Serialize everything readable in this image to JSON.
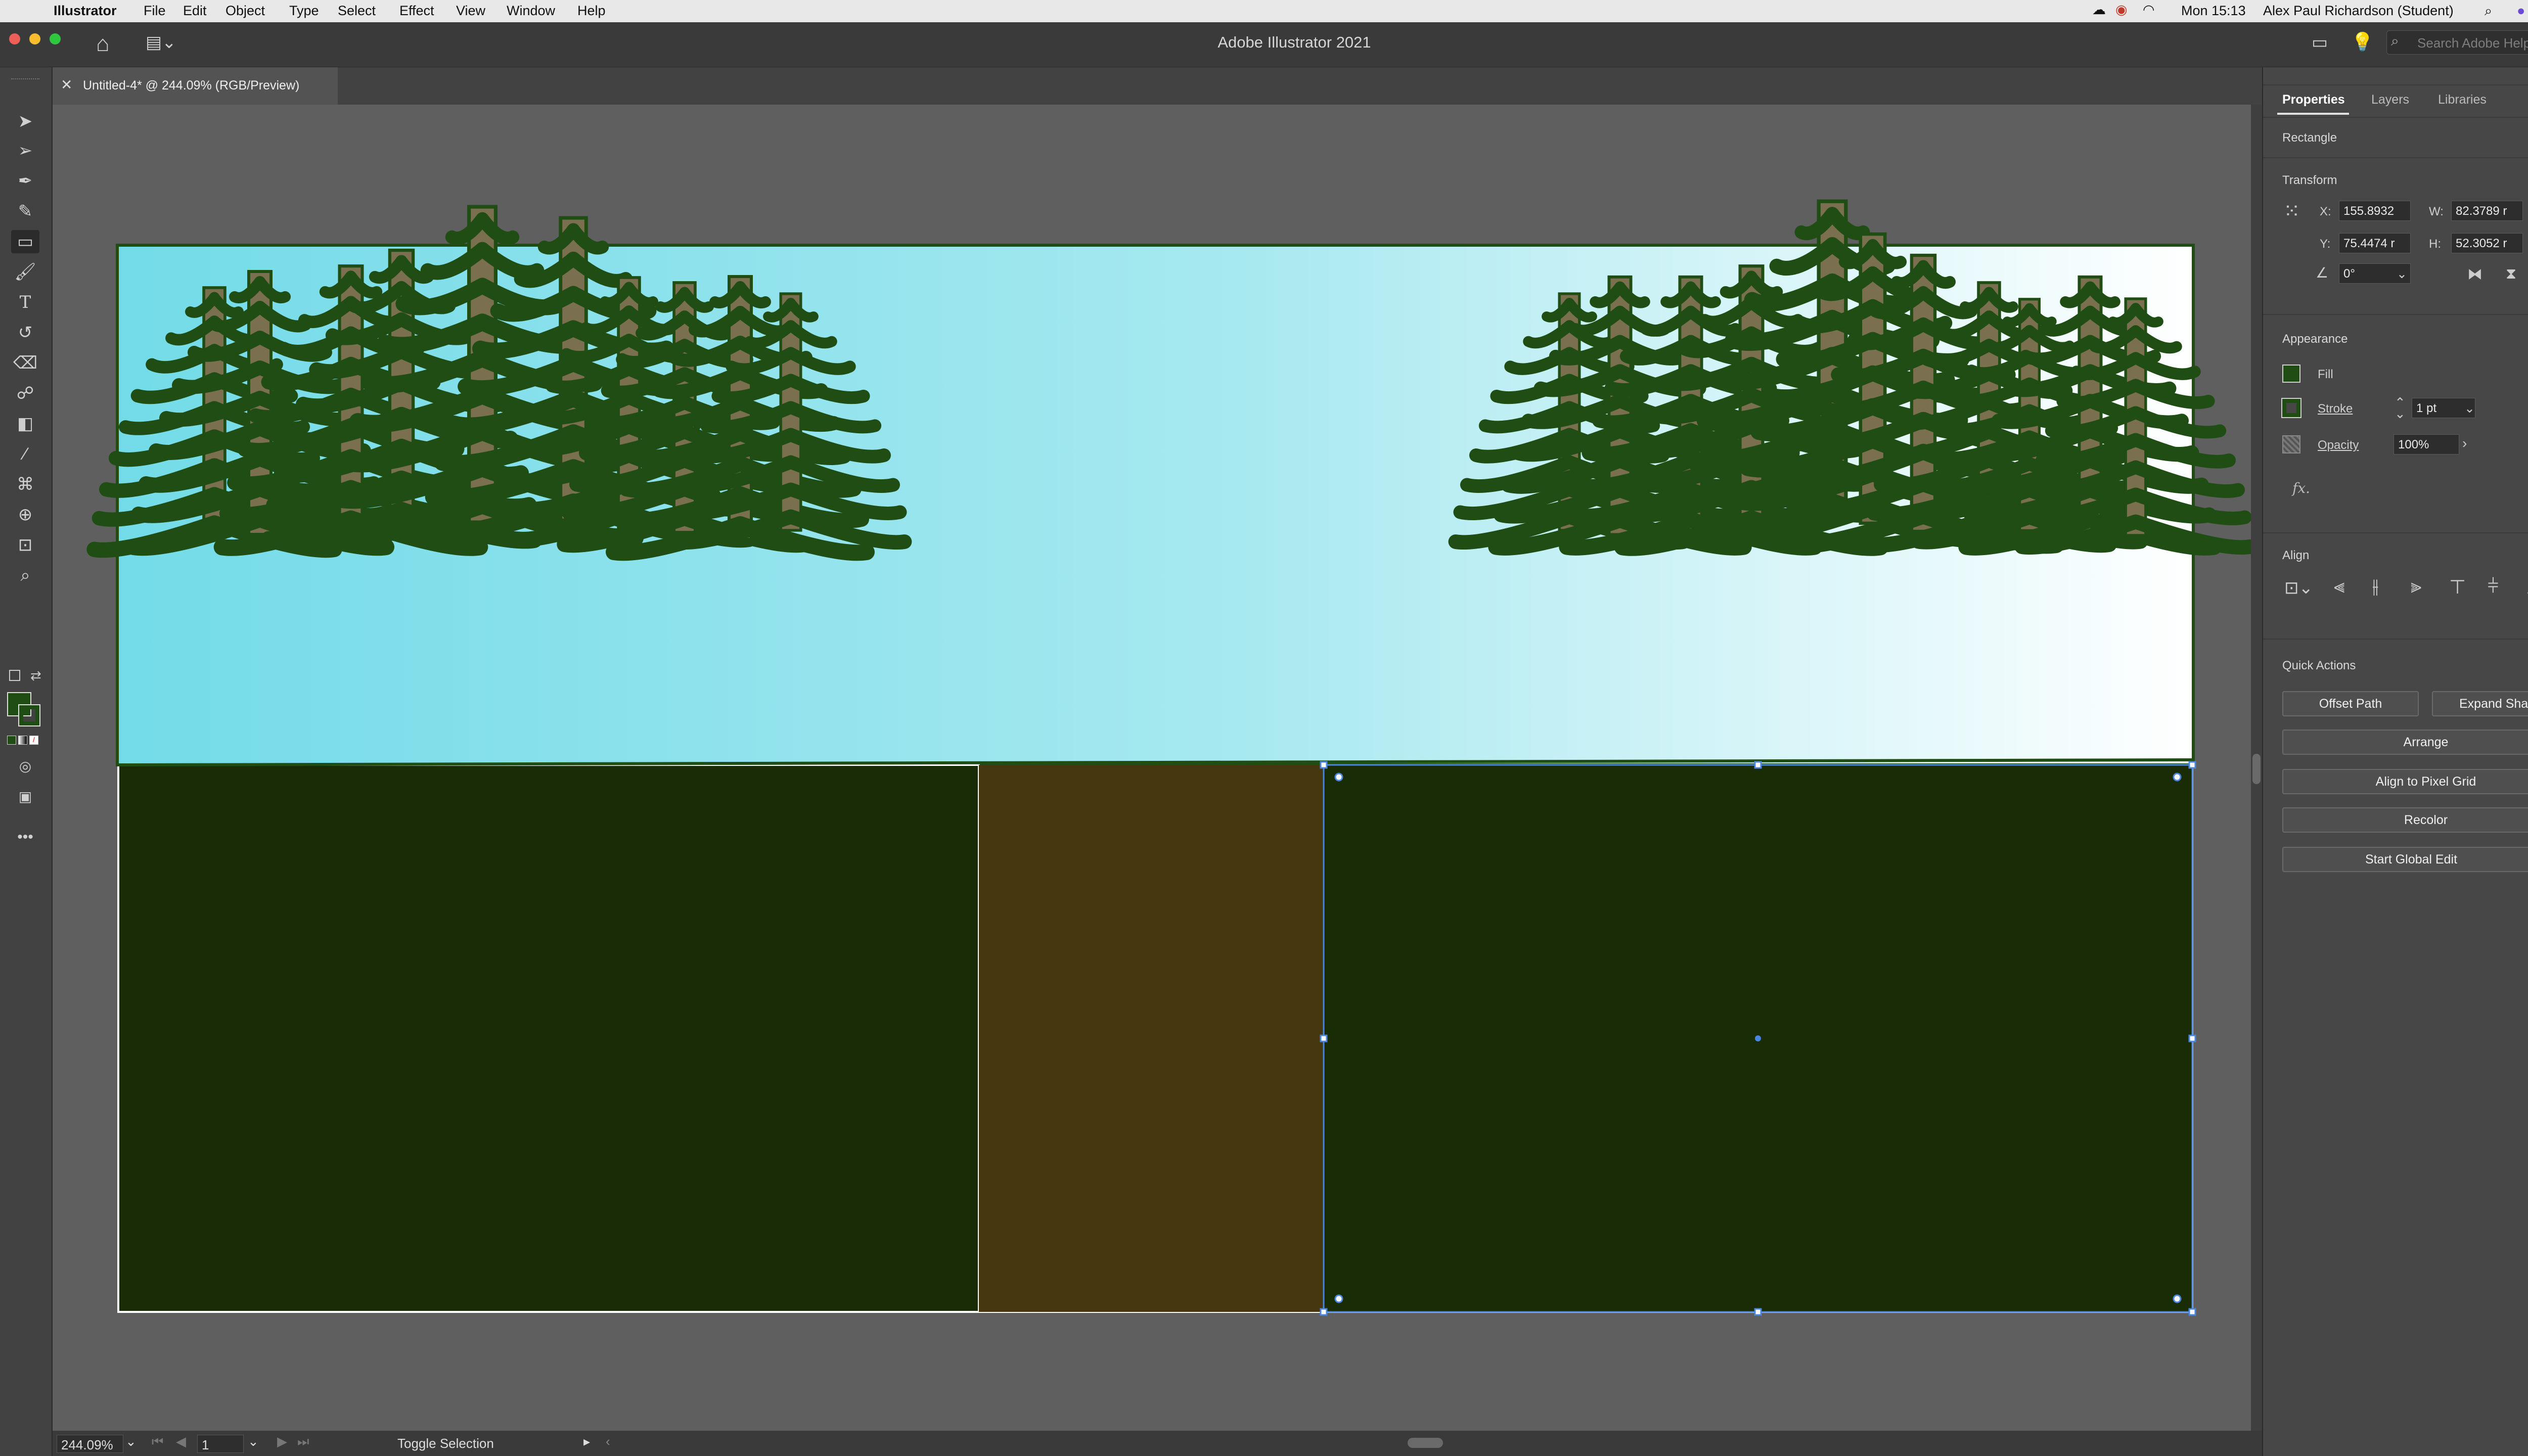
{
  "menubar": {
    "app_name": "Illustrator",
    "items": [
      "File",
      "Edit",
      "Object",
      "Type",
      "Select",
      "Effect",
      "View",
      "Window",
      "Help"
    ],
    "clock": "Mon 15:13",
    "user": "Alex Paul Richardson (Student)"
  },
  "appbar": {
    "title": "Adobe Illustrator 2021",
    "search_placeholder": "Search Adobe Help"
  },
  "document_tab": {
    "label": "Untitled-4* @ 244.09% (RGB/Preview)"
  },
  "panel": {
    "tabs": [
      "Properties",
      "Layers",
      "Libraries"
    ],
    "object_type": "Rectangle",
    "transform": {
      "title": "Transform",
      "x_label": "X:",
      "x_value": "155.8932",
      "y_label": "Y:",
      "y_value": "75.4474 r",
      "w_label": "W:",
      "w_value": "82.3789 r",
      "h_label": "H:",
      "h_value": "52.3052 r",
      "angle_value": "0°"
    },
    "appearance": {
      "title": "Appearance",
      "fill_label": "Fill",
      "stroke_label": "Stroke",
      "stroke_value": "1 pt",
      "opacity_label": "Opacity",
      "opacity_value": "100%",
      "fx_label": "fx."
    },
    "align": {
      "title": "Align"
    },
    "quick_actions": {
      "title": "Quick Actions",
      "offset_path": "Offset Path",
      "expand_shape": "Expand Shape",
      "arrange": "Arrange",
      "align_pixel_grid": "Align to Pixel Grid",
      "recolor": "Recolor",
      "start_global_edit": "Start Global Edit"
    }
  },
  "statusbar": {
    "zoom": "244.09%",
    "artboard": "1",
    "selection_tool": "Toggle Selection"
  },
  "colors": {
    "sky_left": "#73dbe8",
    "sky_right": "#ffffff",
    "tree_foliage": "#1f4d14",
    "trunk": "#7a6f4f",
    "grass": "#1a2c06",
    "path": "#47370f",
    "selection": "#4a86e0"
  }
}
